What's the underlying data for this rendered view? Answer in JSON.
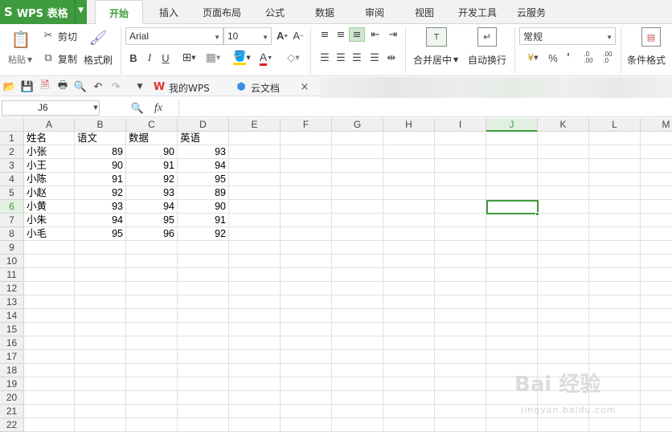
{
  "app": {
    "title": "WPS 表格",
    "logo": "S"
  },
  "tabs": [
    "开始",
    "插入",
    "页面布局",
    "公式",
    "数据",
    "审阅",
    "视图",
    "开发工具",
    "云服务"
  ],
  "ribbon": {
    "paste": "粘贴",
    "cut": "剪切",
    "copy": "复制",
    "format_painter": "格式刷",
    "font": "Arial",
    "size": "10",
    "bold": "B",
    "italic": "I",
    "underline": "U",
    "merge_center": "合并居中",
    "wrap_text": "自动换行",
    "number_format": "常规",
    "percent": "%",
    "comma": "'",
    "cond_format": "条件格式"
  },
  "quickbar": {
    "doc1": "我的WPS",
    "doc2": "云文档"
  },
  "formula_bar": {
    "cell_ref": "J6",
    "fx": "fx"
  },
  "columns": [
    "A",
    "B",
    "C",
    "D",
    "E",
    "F",
    "G",
    "H",
    "I",
    "J",
    "K",
    "L",
    "M"
  ],
  "rows": [
    "1",
    "2",
    "3",
    "4",
    "5",
    "6",
    "7",
    "8",
    "9",
    "10",
    "11",
    "12",
    "13",
    "14",
    "15",
    "16",
    "17",
    "18",
    "19",
    "20",
    "21",
    "22"
  ],
  "table": {
    "header": [
      "姓名",
      "语文",
      "数据",
      "英语"
    ],
    "data": [
      [
        "小张",
        "89",
        "90",
        "93"
      ],
      [
        "小王",
        "90",
        "91",
        "94"
      ],
      [
        "小陈",
        "91",
        "92",
        "95"
      ],
      [
        "小赵",
        "92",
        "93",
        "89"
      ],
      [
        "小黄",
        "93",
        "94",
        "90"
      ],
      [
        "小朱",
        "94",
        "95",
        "91"
      ],
      [
        "小毛",
        "95",
        "96",
        "92"
      ]
    ]
  },
  "selected": {
    "col": "J",
    "row": "6"
  },
  "watermark": {
    "main": "Bai 经验",
    "sub": "jingyan.baidu.com"
  }
}
